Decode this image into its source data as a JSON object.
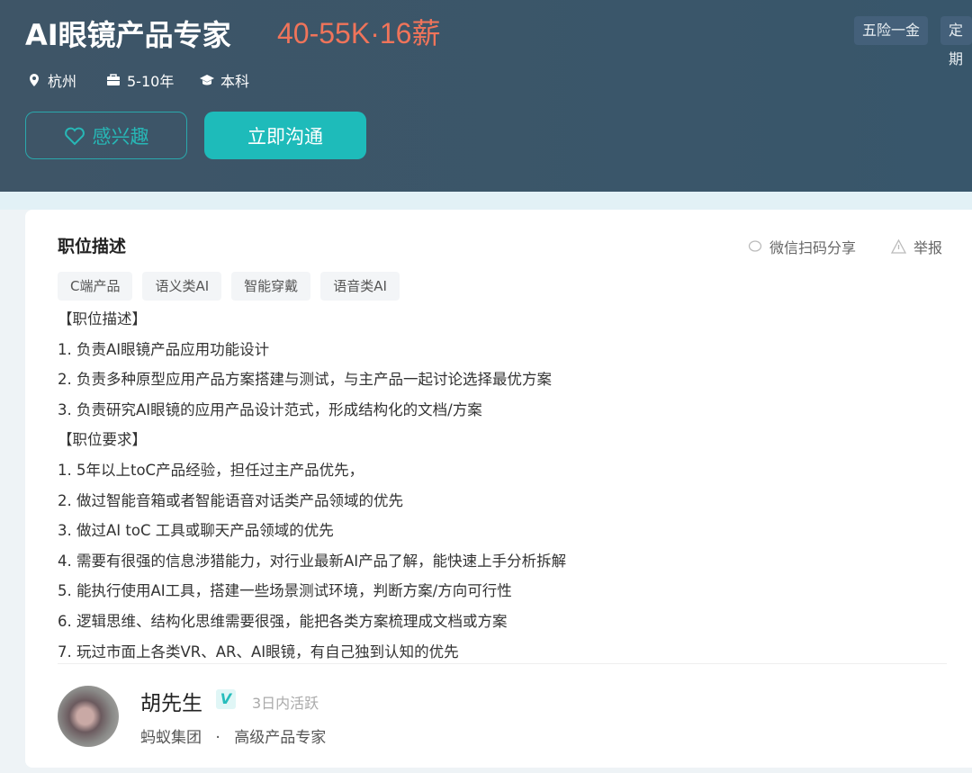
{
  "header": {
    "title": "AI眼镜产品专家",
    "salary": "40-55K·16薪",
    "meta": [
      {
        "icon": "location-icon",
        "text": "杭州"
      },
      {
        "icon": "briefcase-icon",
        "text": "5-10年"
      },
      {
        "icon": "graduation-cap-icon",
        "text": "本科"
      }
    ],
    "like_label": "感兴趣",
    "chat_label": "立即沟通",
    "welfare": [
      "五险一金",
      "定期"
    ]
  },
  "section": {
    "title": "职位描述",
    "share_label": "微信扫码分享",
    "report_label": "举报",
    "tags": [
      "C端产品",
      "语义类AI",
      "智能穿戴",
      "语音类AI"
    ],
    "lines": [
      "【职位描述】",
      "1. 负责AI眼镜产品应用功能设计",
      "2. 负责多种原型应用产品方案搭建与测试，与主产品一起讨论选择最优方案",
      "3. 负责研究AI眼镜的应用产品设计范式，形成结构化的文档/方案",
      "【职位要求】",
      "1. 5年以上toC产品经验，担任过主产品优先，",
      "2. 做过智能音箱或者智能语音对话类产品领域的优先",
      "3. 做过AI toC 工具或聊天产品领域的优先",
      "4. 需要有很强的信息涉猎能力，对行业最新AI产品了解，能快速上手分析拆解",
      "5. 能执行使用AI工具，搭建一些场景测试环境，判断方案/方向可行性",
      "6. 逻辑思维、结构化思维需要很强，能把各类方案梳理成文档或方案",
      "7. 玩过市面上各类VR、AR、AI眼镜，有自己独到认知的优先"
    ]
  },
  "recruiter": {
    "name": "胡先生",
    "verified_badge": "V",
    "active": "3日内活跃",
    "company": "蚂蚁集团",
    "separator": "·",
    "position": "高级产品专家"
  },
  "colors": {
    "header_bg": "#3e5567",
    "salary": "#f0745a",
    "accent": "#1ebbba"
  }
}
